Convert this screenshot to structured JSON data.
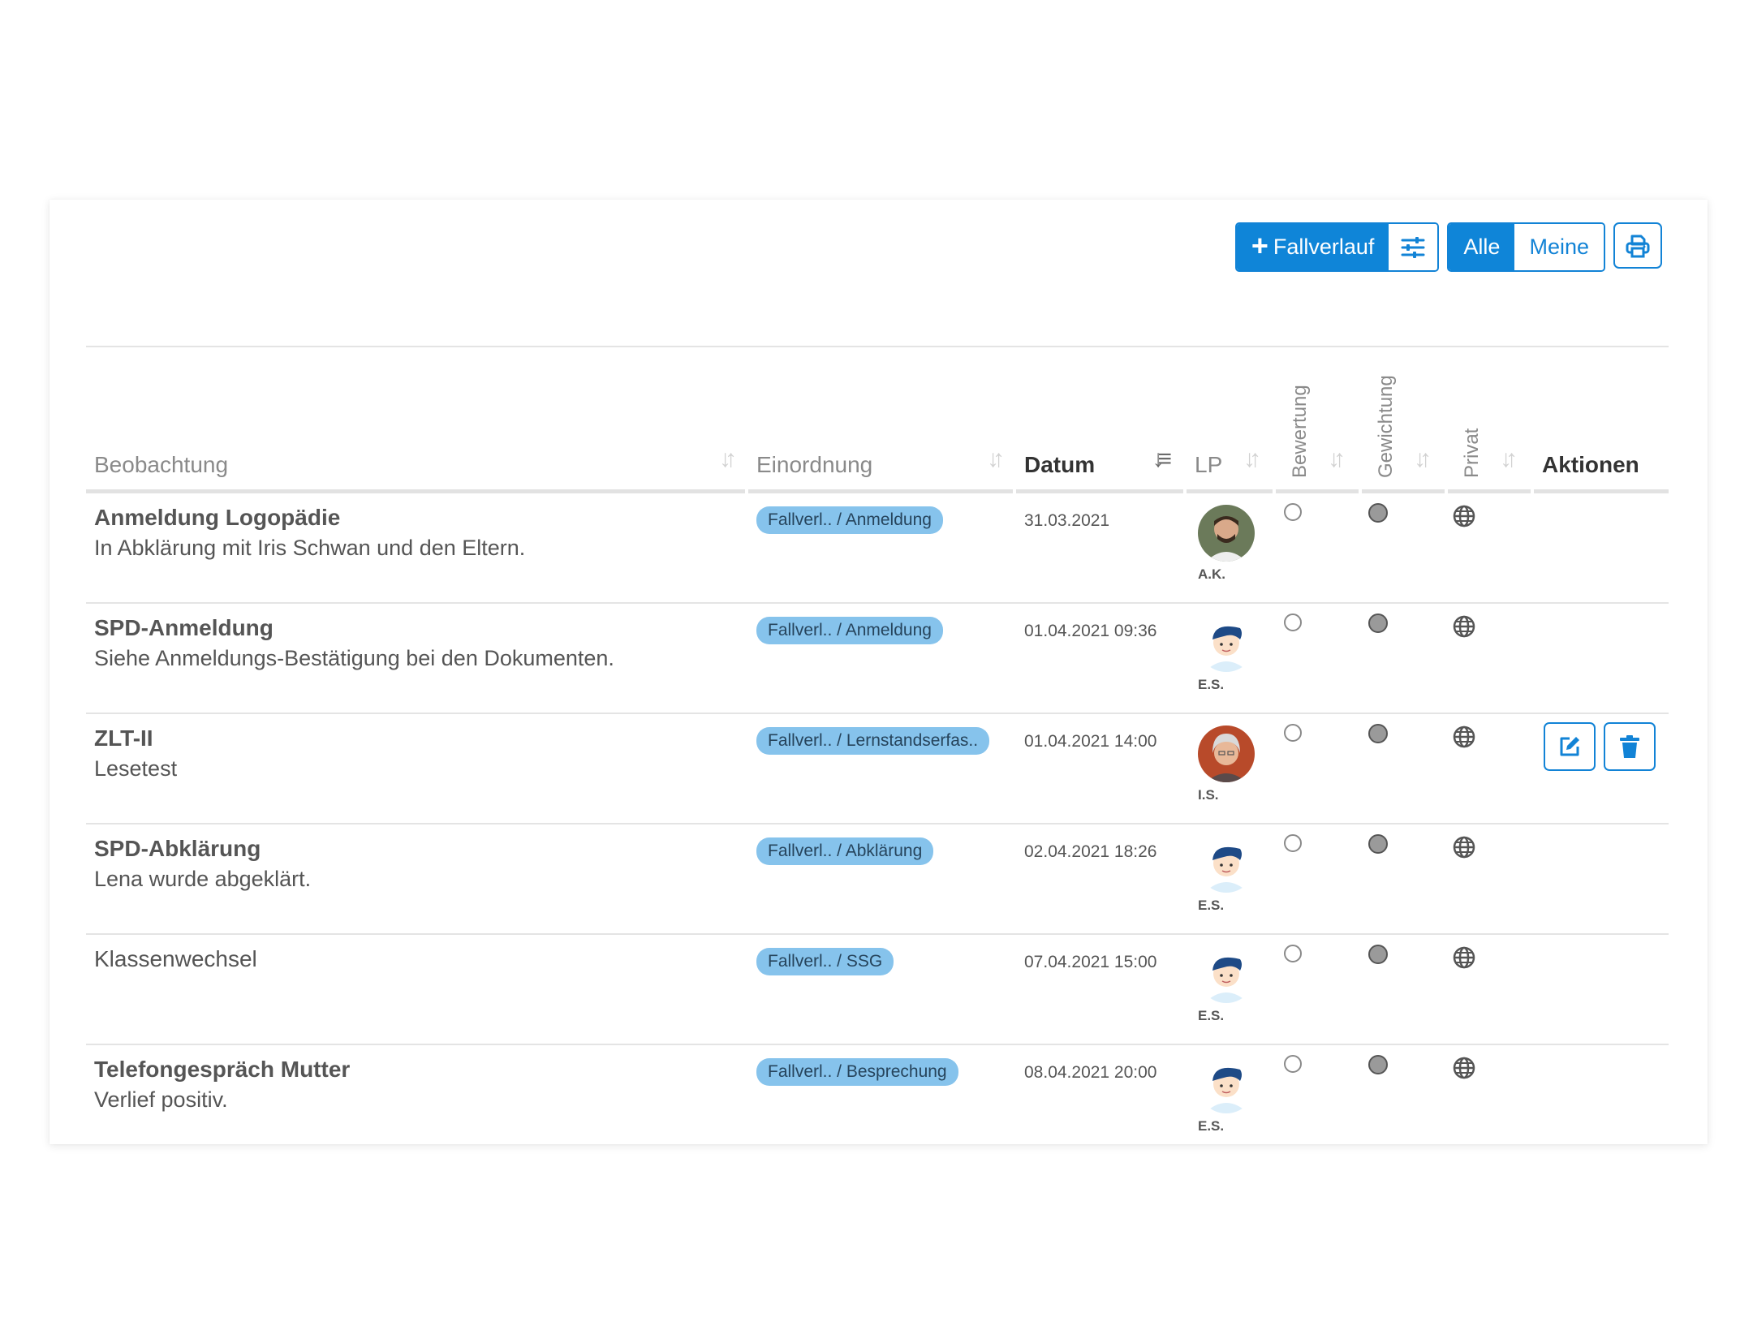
{
  "toolbar": {
    "add_label": "Fallverlauf",
    "filter_all": "Alle",
    "filter_mine": "Meine"
  },
  "columns": {
    "beobachtung": "Beobachtung",
    "einordnung": "Einordnung",
    "datum": "Datum",
    "lp": "LP",
    "bewertung": "Bewertung",
    "gewichtung": "Gewichtung",
    "privat": "Privat",
    "aktionen": "Aktionen"
  },
  "rows": [
    {
      "title": "Anmeldung Logopädie",
      "desc": "In Abklärung mit Iris Schwan und den Eltern.",
      "badge": "Fallverl.. / Anmeldung",
      "date": "31.03.2021",
      "initials": "A.K.",
      "avatar": "photo-man"
    },
    {
      "title": "SPD-Anmeldung",
      "desc": "Siehe Anmeldungs-Bestätigung bei den Dokumenten.",
      "badge": "Fallverl.. / Anmeldung",
      "date": "01.04.2021 09:36",
      "initials": "E.S.",
      "avatar": "cartoon"
    },
    {
      "title": "ZLT-II",
      "desc": "Lesetest",
      "badge": "Fallverl.. / Lernstandserfas..",
      "date": "01.04.2021 14:00",
      "initials": "I.S.",
      "avatar": "photo-woman"
    },
    {
      "title": "SPD-Abklärung",
      "desc": "Lena wurde abgeklärt.",
      "badge": "Fallverl.. / Abklärung",
      "date": "02.04.2021 18:26",
      "initials": "E.S.",
      "avatar": "cartoon"
    },
    {
      "title": "Klassenwechsel",
      "desc": "",
      "badge": "Fallverl.. / SSG",
      "date": "07.04.2021 15:00",
      "initials": "E.S.",
      "avatar": "cartoon"
    },
    {
      "title": "Telefongespräch Mutter",
      "desc": "Verlief positiv.",
      "badge": "Fallverl.. / Besprechung",
      "date": "08.04.2021 20:00",
      "initials": "E.S.",
      "avatar": "cartoon"
    }
  ],
  "colors": {
    "accent": "#0f85d8",
    "badge": "#86c3ec"
  }
}
